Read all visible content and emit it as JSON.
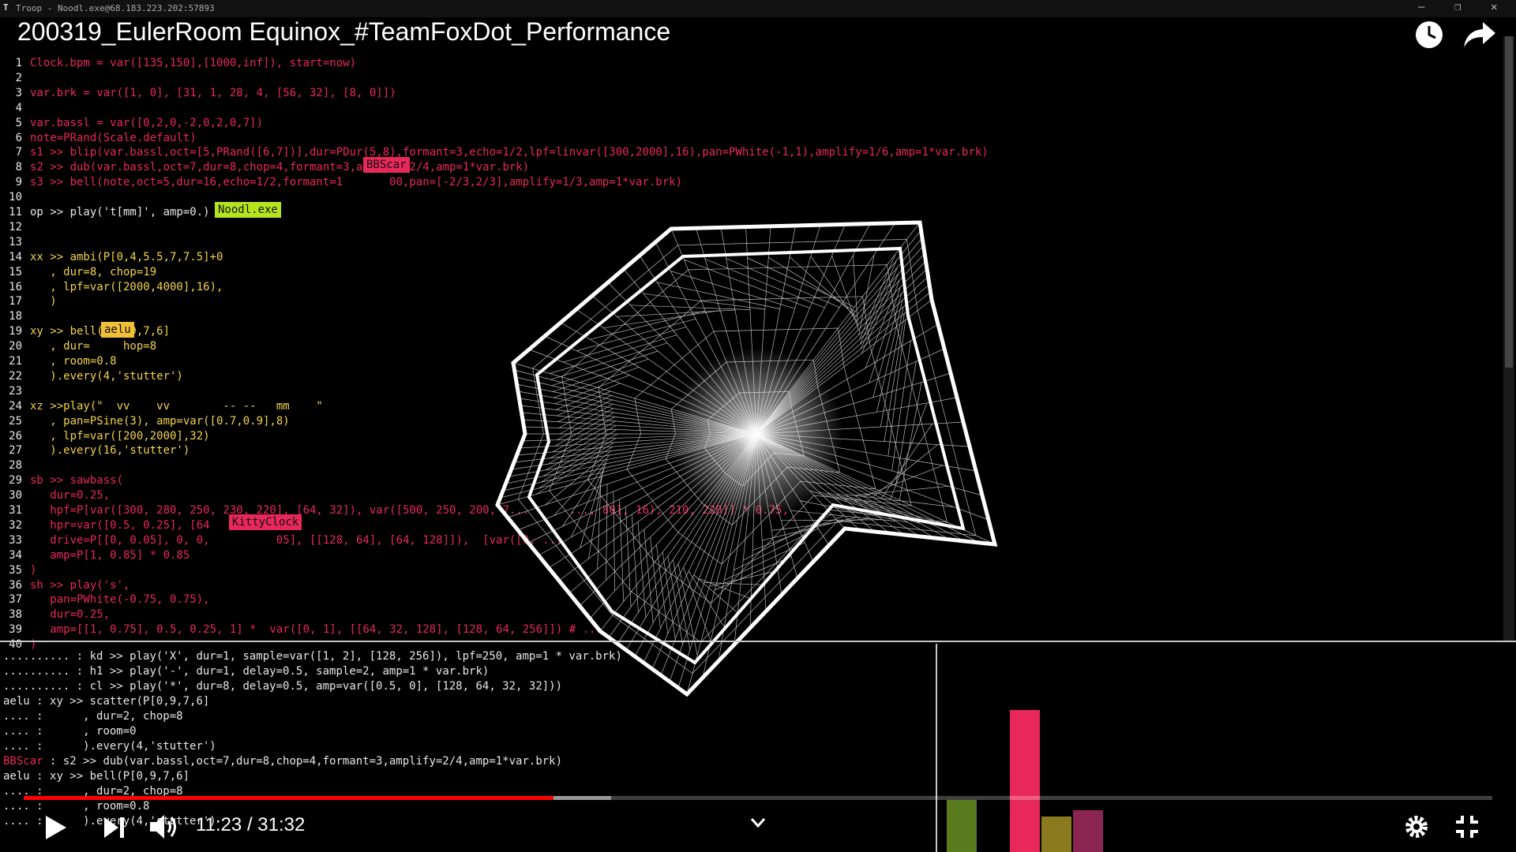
{
  "window": {
    "title": "Troop - Noodl.exe@68.183.223.202:57893"
  },
  "video": {
    "title": "200319_EulerRoom Equinox_#TeamFoxDot_Performance"
  },
  "editor": {
    "lines": [
      {
        "n": "1",
        "text": "Clock.bpm = var([135,150],[1000,inf]), start=now)",
        "cls": "red"
      },
      {
        "n": "2",
        "text": "",
        "cls": "red"
      },
      {
        "n": "3",
        "text": "var.brk = var([1, 0], [31, 1, 28, 4, [56, 32], [8, 0]])",
        "cls": "red"
      },
      {
        "n": "4",
        "text": "",
        "cls": "red"
      },
      {
        "n": "5",
        "text": "var.bassl = var([0,2,0,-2,0,2,0,7])",
        "cls": "red"
      },
      {
        "n": "6",
        "text": "note=PRand(Scale.default)",
        "cls": "red"
      },
      {
        "n": "7",
        "text": "s1 >> blip(var.bassl,oct=[5,PRand([6,7])],dur=PDur(5,8),formant=3,echo=1/2,lpf=linvar([300,2000],16),pan=PWhite(-1,1),amplify=1/6,amp=1*var.brk)",
        "cls": "red"
      },
      {
        "n": "8",
        "text": "s2 >> dub(var.bassl,oct=7,dur=8,chop=4,formant=3,amplify=2/4,amp=1*var.brk)",
        "cls": "red"
      },
      {
        "n": "9",
        "text": "s3 >> bell(note,oct=5,dur=16,echo=1/2,formant=1       00,pan=[-2/3,2/3],amplify=1/3,amp=1*var.brk)",
        "cls": "red"
      },
      {
        "n": "10",
        "text": "",
        "cls": "wht"
      },
      {
        "n": "11",
        "text": "op >> play('t[mm]', amp=0.)",
        "cls": "wht"
      },
      {
        "n": "12",
        "text": "",
        "cls": "wht"
      },
      {
        "n": "13",
        "text": "",
        "cls": "wht"
      },
      {
        "n": "14",
        "text": "xx >> ambi(P[0,4,5.5,7,7.5]+0",
        "cls": "yel"
      },
      {
        "n": "15",
        "text": "   , dur=8, chop=19",
        "cls": "yel"
      },
      {
        "n": "16",
        "text": "   , lpf=var([2000,4000],16),",
        "cls": "yel"
      },
      {
        "n": "17",
        "text": "   )",
        "cls": "yel"
      },
      {
        "n": "18",
        "text": "",
        "cls": "yel"
      },
      {
        "n": "19",
        "text": "xy >> bell(P[0,9,7,6]",
        "cls": "yel"
      },
      {
        "n": "20",
        "text": "   , dur=     hop=8",
        "cls": "yel"
      },
      {
        "n": "21",
        "text": "   , room=0.8",
        "cls": "yel"
      },
      {
        "n": "22",
        "text": "   ).every(4,'stutter')",
        "cls": "yel"
      },
      {
        "n": "23",
        "text": "",
        "cls": "yel"
      },
      {
        "n": "24",
        "text": "xz >>play(\"  vv    vv        -- --   mm    \"",
        "cls": "yel"
      },
      {
        "n": "25",
        "text": "   , pan=PSine(3), amp=var([0.7,0.9],8)",
        "cls": "yel"
      },
      {
        "n": "26",
        "text": "   , lpf=var([200,2000],32)",
        "cls": "yel"
      },
      {
        "n": "27",
        "text": "   ).every(16,'stutter')",
        "cls": "yel"
      },
      {
        "n": "28",
        "text": "",
        "cls": "yel"
      },
      {
        "n": "29",
        "text": "sb >> sawbass(",
        "cls": "red"
      },
      {
        "n": "30",
        "text": "   dur=0.25,",
        "cls": "red"
      },
      {
        "n": "31",
        "text": "   hpf=P[var([300, 280, 250, 230, 220], [64, 32]), var([500, 250, 200, 7...      ..., 80], 16), 210, 220]] * 0.75,",
        "cls": "red"
      },
      {
        "n": "32",
        "text": "   hpr=var([0.5, 0.25], [64",
        "cls": "red"
      },
      {
        "n": "33",
        "text": "   drive=P[[0, 0.05], 0, 0,          05], [[128, 64], [64, 128]]),  [var([0, ...",
        "cls": "red"
      },
      {
        "n": "34",
        "text": "   amp=P[1, 0.85] * 0.85",
        "cls": "red"
      },
      {
        "n": "35",
        "text": ")",
        "cls": "red"
      },
      {
        "n": "36",
        "text": "sh >> play('s',",
        "cls": "red"
      },
      {
        "n": "37",
        "text": "   pan=PWhite(-0.75, 0.75),",
        "cls": "red"
      },
      {
        "n": "38",
        "text": "   dur=0.25,",
        "cls": "red"
      },
      {
        "n": "39",
        "text": "   amp=[[1, 0.75], 0.5, 0.25, 1] *  var([0, 1], [[64, 32, 128], [128, 64, 256]]) # ...",
        "cls": "red"
      },
      {
        "n": "40",
        "text": ")",
        "cls": "red"
      }
    ],
    "cursor_tags": [
      {
        "label": "BBScar",
        "color": "#e8285a"
      },
      {
        "label": "Noodl.exe",
        "color": "#b5e61d"
      },
      {
        "label": "aelu",
        "color": "#f2c038"
      },
      {
        "label": "KittyClock",
        "color": "#e8285a"
      }
    ]
  },
  "console": {
    "lines": [
      {
        "who": "..........",
        "sep": " : ",
        "text": "kd >> play('X', dur=1, sample=var([1, 2], [128, 256]), lpf=250, amp=1 * var.brk)"
      },
      {
        "who": "..........",
        "sep": " : ",
        "text": "h1 >> play('-', dur=1, delay=0.5, sample=2, amp=1 * var.brk)"
      },
      {
        "who": "..........",
        "sep": " : ",
        "text": "cl >> play('*', dur=8, delay=0.5, amp=var([0.5, 0], [128, 64, 32, 32]))"
      },
      {
        "who": "aelu",
        "sep": " : ",
        "text": "xy >> scatter(P[0,9,7,6]"
      },
      {
        "who": "....",
        "sep": " :      ",
        "text": ", dur=2, chop=8"
      },
      {
        "who": "....",
        "sep": " :      ",
        "text": ", room=0"
      },
      {
        "who": "....",
        "sep": " :      ",
        "text": ").every(4,'stutter')"
      },
      {
        "who": "BBScar",
        "sep": " : ",
        "text": "s2 >> dub(var.bassl,oct=7,dur=8,chop=4,formant=3,amplify=2/4,amp=1*var.brk)"
      },
      {
        "who": "aelu",
        "sep": " : ",
        "text": "xy >> bell(P[0,9,7,6]"
      },
      {
        "who": "....",
        "sep": " :      ",
        "text": ", dur=2, chop=8"
      },
      {
        "who": "....",
        "sep": " :      ",
        "text": ", room=0.8"
      },
      {
        "who": "....",
        "sep": " :      ",
        "text": ").every(4,'stutter')"
      }
    ]
  },
  "visualizer": {
    "bars": [
      {
        "level": 0.25,
        "color": "#5a7a1e"
      },
      {
        "level": 0.68,
        "color": "#e8285a"
      },
      {
        "level": 0.17,
        "color": "#8a7a1e"
      },
      {
        "level": 0.2,
        "color": "#8a2450"
      }
    ]
  },
  "player": {
    "current_time": "11:23",
    "duration": "31:32",
    "time_display": "11:23 / 31:32",
    "played_fraction": 0.361,
    "buffered_fraction": 0.4
  },
  "icons": [
    "clock-icon",
    "share-icon",
    "play-icon",
    "next-icon",
    "volume-icon",
    "chevron-down-icon",
    "settings-icon",
    "exit-fullscreen-icon"
  ]
}
